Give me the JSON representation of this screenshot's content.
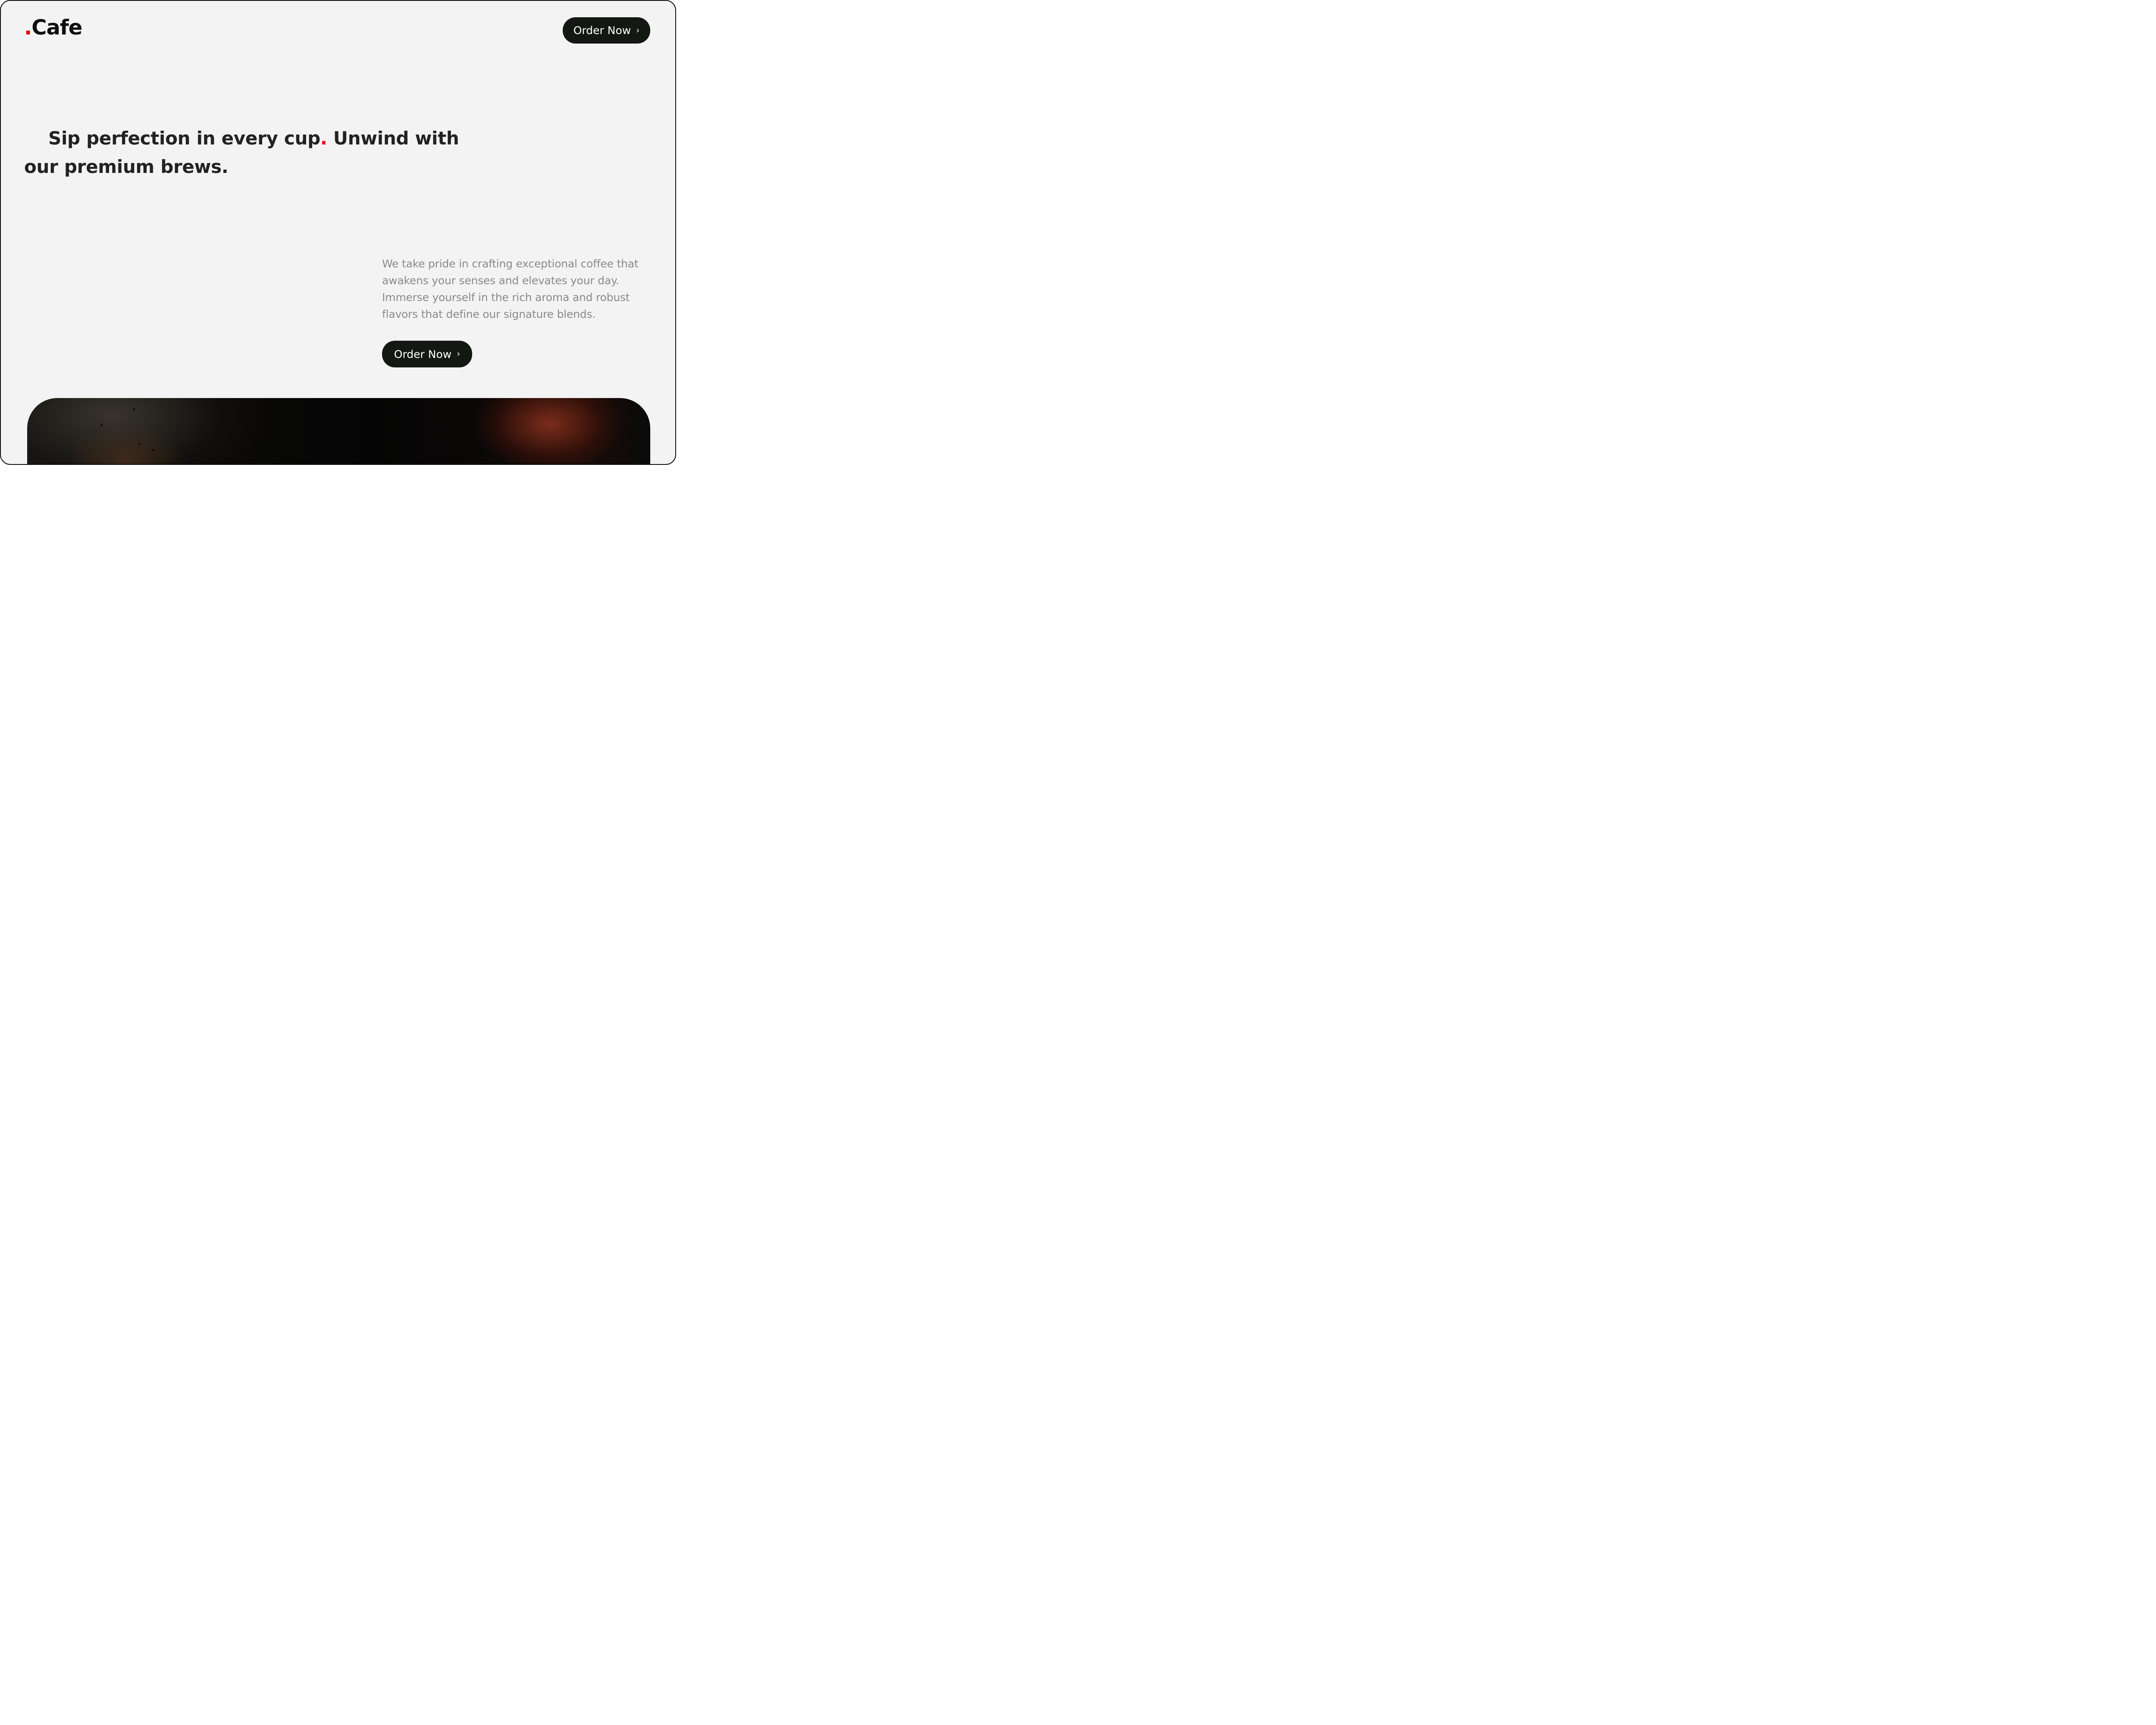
{
  "header": {
    "logo_dot": ".",
    "logo_text": "Cafe",
    "cta_label": "Order Now",
    "cta_icon": "chevron-right-icon"
  },
  "hero": {
    "headline_part1": "Sip perfection in every cup",
    "headline_accent": ".",
    "headline_part2": " Unwind with our premium brews.",
    "description": "We take pride in crafting exceptional coffee that awakens your senses and elevates your day. Immerse yourself in the rich aroma and robust flavors that define our signature blends.",
    "cta_label": "Order Now",
    "cta_icon": "chevron-right-icon"
  },
  "colors": {
    "background": "#f3f3f3",
    "text": "#222222",
    "muted_text": "#8a8a8a",
    "accent": "#e10000",
    "button": "#141812",
    "button_text": "#ffffff"
  },
  "image": {
    "subject": "coffee-photo"
  }
}
